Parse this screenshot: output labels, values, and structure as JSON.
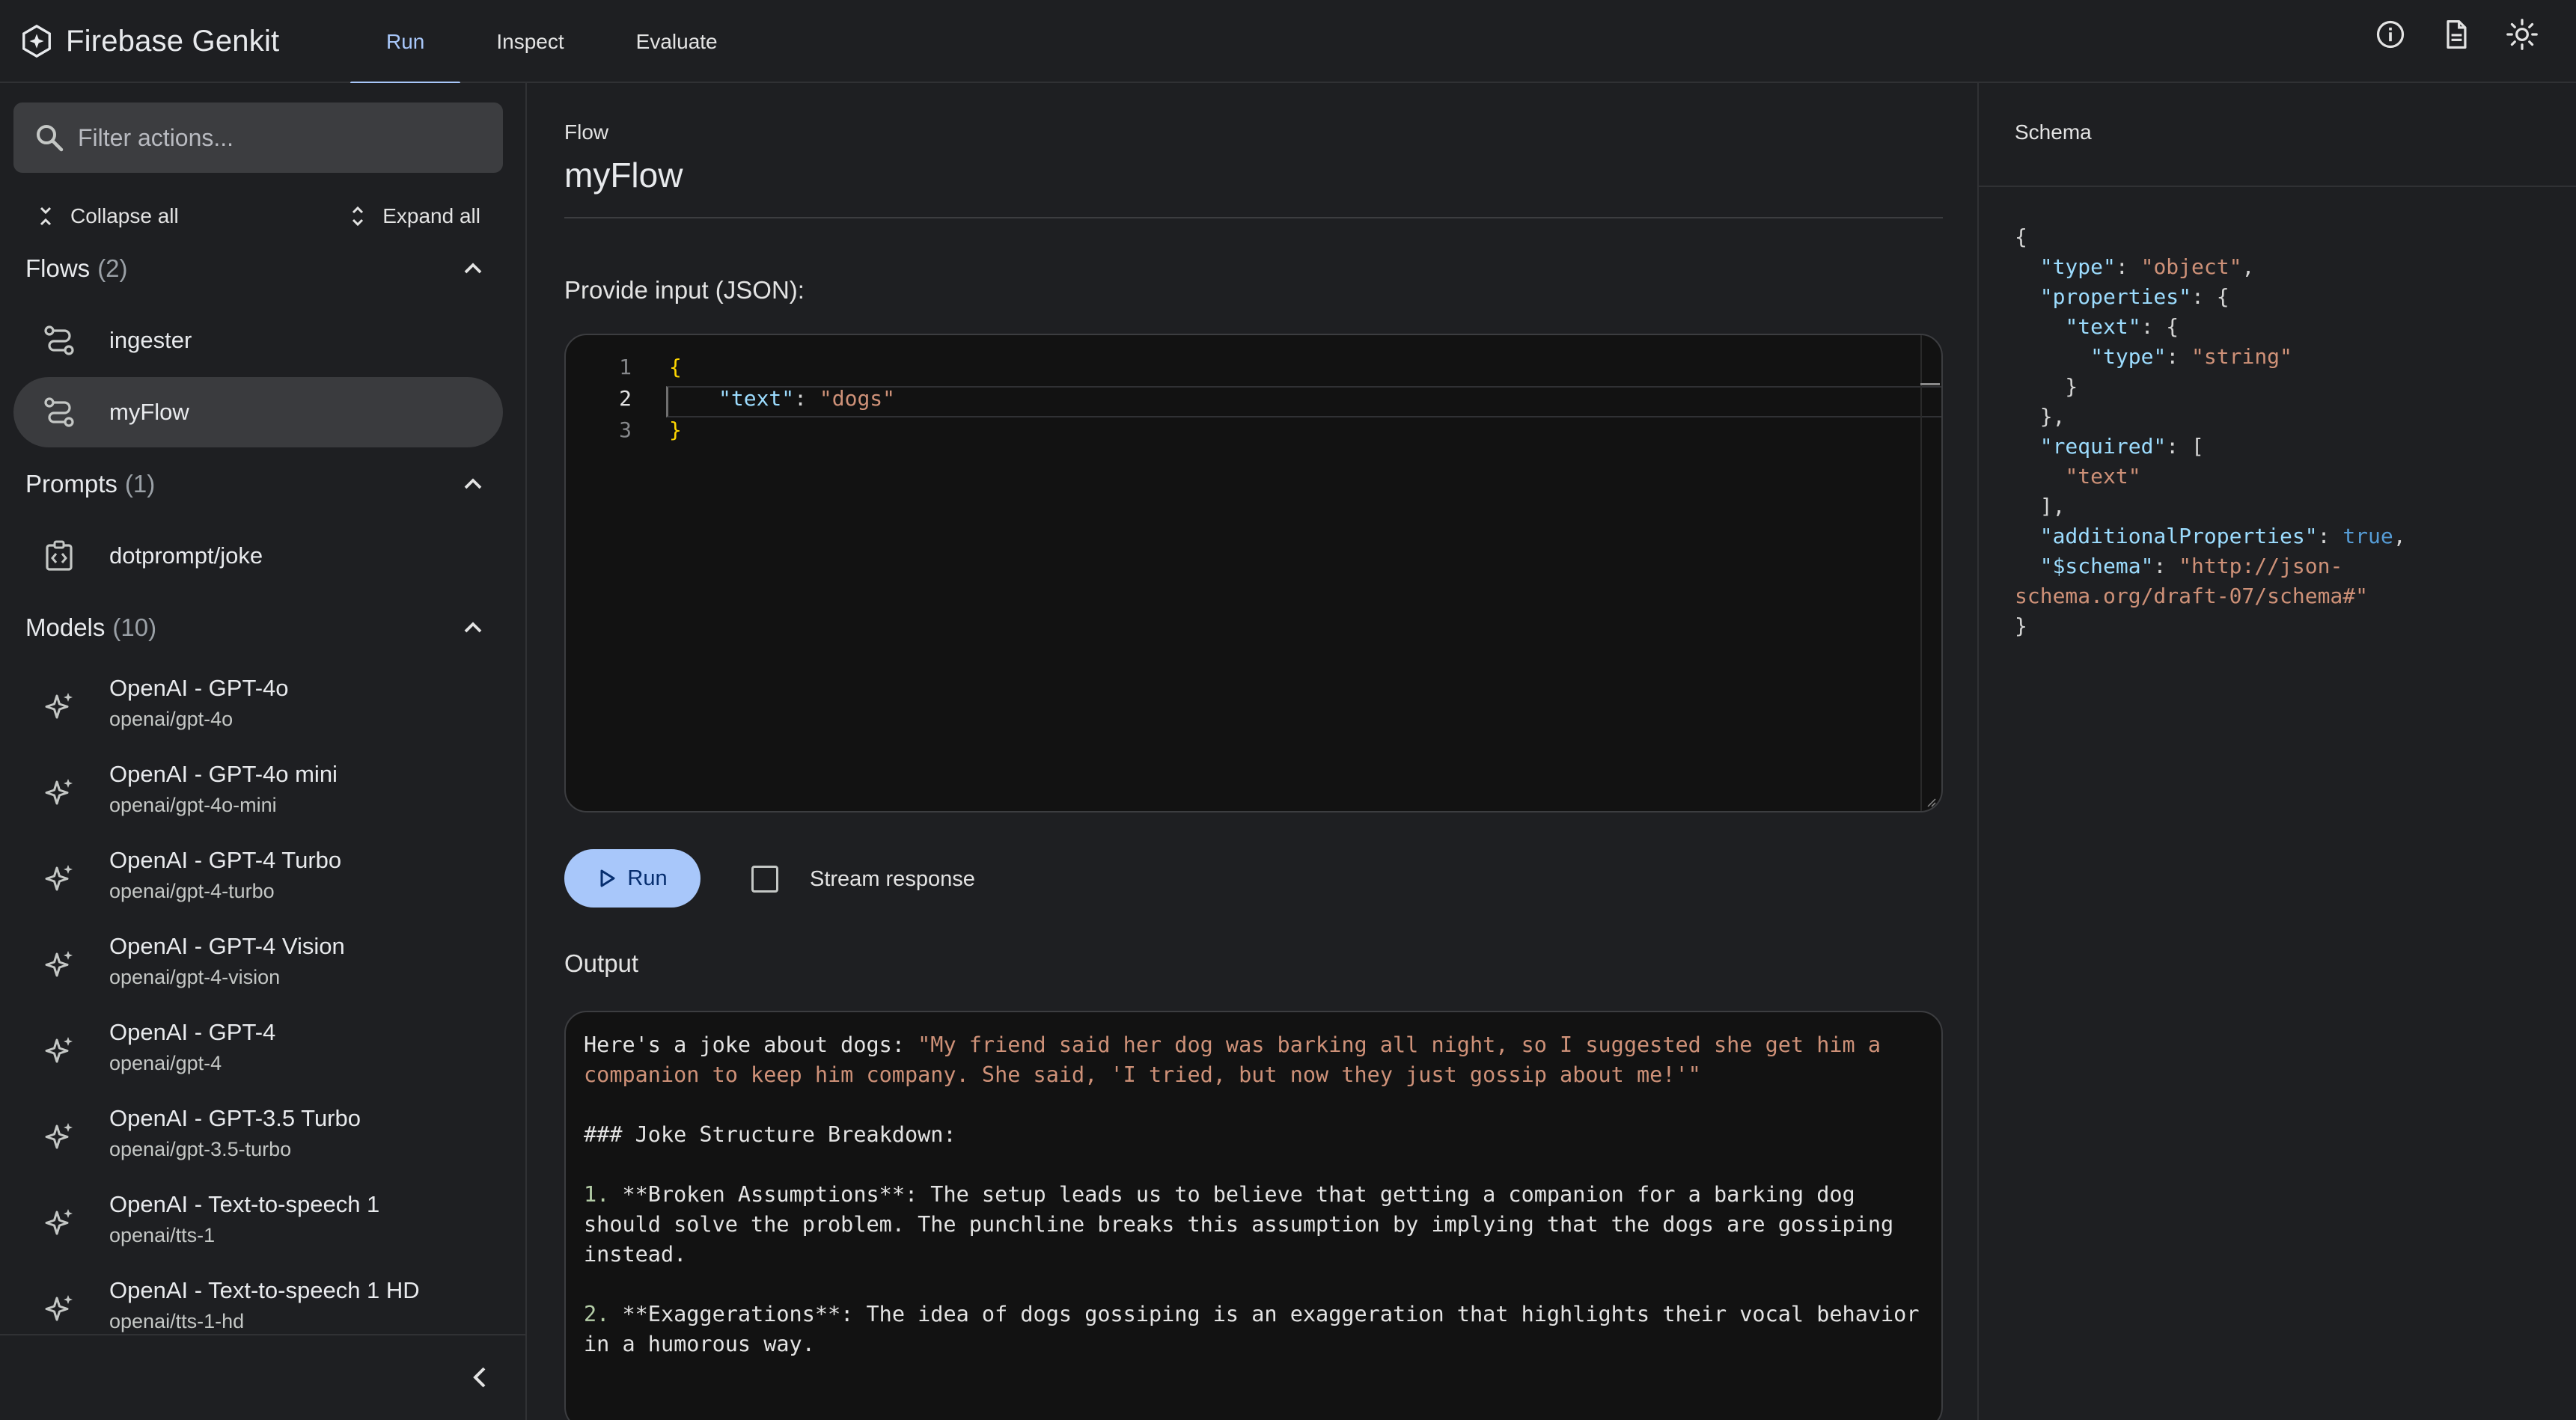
{
  "app": {
    "title": "Firebase Genkit",
    "logo_icon": "genkit-logo-icon"
  },
  "nav": {
    "tabs": [
      {
        "label": "Run",
        "active": true
      },
      {
        "label": "Inspect",
        "active": false
      },
      {
        "label": "Evaluate",
        "active": false
      }
    ],
    "icons": [
      "info-icon",
      "docs-icon",
      "theme-toggle-icon"
    ]
  },
  "sidebar": {
    "filter_placeholder": "Filter actions...",
    "collapse_all": "Collapse all",
    "expand_all": "Expand all",
    "flows": {
      "title": "Flows",
      "count": "(2)",
      "items": [
        {
          "label": "ingester",
          "active": false
        },
        {
          "label": "myFlow",
          "active": true
        }
      ]
    },
    "prompts": {
      "title": "Prompts",
      "count": "(1)",
      "items": [
        {
          "label": "dotprompt/joke"
        }
      ]
    },
    "models": {
      "title": "Models",
      "count": "(10)",
      "items": [
        {
          "name": "OpenAI - GPT-4o",
          "id": "openai/gpt-4o"
        },
        {
          "name": "OpenAI - GPT-4o mini",
          "id": "openai/gpt-4o-mini"
        },
        {
          "name": "OpenAI - GPT-4 Turbo",
          "id": "openai/gpt-4-turbo"
        },
        {
          "name": "OpenAI - GPT-4 Vision",
          "id": "openai/gpt-4-vision"
        },
        {
          "name": "OpenAI - GPT-4",
          "id": "openai/gpt-4"
        },
        {
          "name": "OpenAI - GPT-3.5 Turbo",
          "id": "openai/gpt-3.5-turbo"
        },
        {
          "name": "OpenAI - Text-to-speech 1",
          "id": "openai/tts-1"
        },
        {
          "name": "OpenAI - Text-to-speech 1 HD",
          "id": "openai/tts-1-hd"
        }
      ]
    }
  },
  "main": {
    "kind": "Flow",
    "title": "myFlow",
    "input_label": "Provide input (JSON):",
    "editor": {
      "line_numbers": [
        "1",
        "2",
        "3"
      ],
      "open_brace": "{",
      "key": "\"text\"",
      "colon": ": ",
      "value": "\"dogs\"",
      "close_brace": "}"
    },
    "run_label": "Run",
    "stream_label": "Stream response",
    "stream_checked": false,
    "output_label": "Output",
    "output": {
      "intro": "Here's a joke about dogs: ",
      "joke": "\"My friend said her dog was barking all night, so I suggested she get him a companion to keep him company. She said, 'I tried, but now they just gossip about me!'\"",
      "heading": "### Joke Structure Breakdown:",
      "point1_num": "1.",
      "point1_text": " **Broken Assumptions**: The setup leads us to believe that getting a companion for a barking dog should solve the problem. The punchline breaks this assumption by implying that the dogs are gossiping instead.",
      "point2_num": "2.",
      "point2_text": " **Exaggerations**: The idea of dogs gossiping is an exaggeration that highlights their vocal behavior in a humorous way."
    }
  },
  "schema": {
    "title": "Schema",
    "lines": {
      "l1": "{",
      "type_key": "\"type\"",
      "type_val": "\"object\"",
      "props_key": "\"properties\"",
      "text_key": "\"text\"",
      "inner_type_key": "\"type\"",
      "inner_type_val": "\"string\"",
      "req_key": "\"required\"",
      "req_item": "\"text\"",
      "addl_key": "\"additionalProperties\"",
      "addl_val": "true",
      "schema_key": "\"$schema\"",
      "schema_val_1": "\"http://json-",
      "schema_val_2": "schema.org/draft-07/schema#\"",
      "last": "}"
    }
  },
  "colors": {
    "accent": "#a8c7fa",
    "background": "#1e1f22",
    "editor_bg": "#121212",
    "json_key": "#9cdcfe",
    "json_string": "#ce9178",
    "json_bool": "#569cd6",
    "json_brace": "#ffd700"
  }
}
